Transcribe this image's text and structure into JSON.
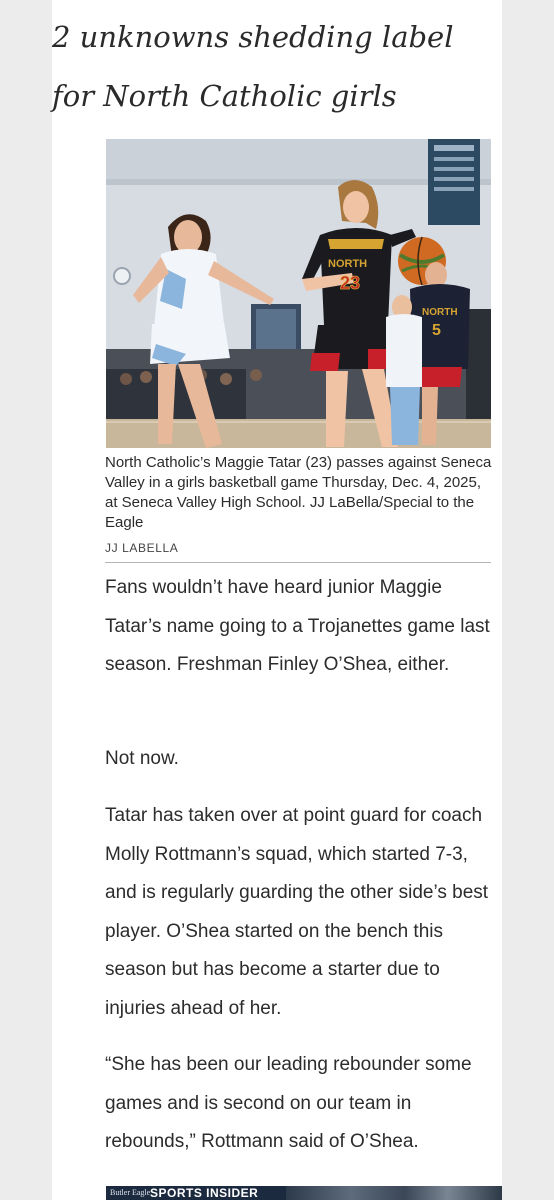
{
  "article": {
    "headline_line1": "2 unknowns shedding label",
    "headline_line2": "for North Catholic girls",
    "photo": {
      "description_icon": "basketball-photo",
      "jersey_text_front": "NORTH",
      "jersey_number_front": "23",
      "jersey_text_back": "NORTH",
      "jersey_number_back": "5"
    },
    "caption": "North Catholic’s Maggie Tatar (23) passes against Seneca Valley in a girls basketball game Thursday, Dec. 4, 2025, at Seneca Valley High School. JJ LaBella/Special to the Eagle",
    "credit": "JJ LABELLA",
    "paragraphs": [
      "Fans wouldn’t have heard junior Maggie Tatar’s name going to a Trojanettes game last season. Freshman Finley O’Shea, either.",
      "Not now.",
      "Tatar has taken over at point guard for coach Molly Rottmann’s squad, which started 7-3, and is regularly guarding the other side’s best player. O’Shea started on the bench this season but has become a starter due to injuries ahead of her.",
      "“She has been our leading rebounder some games and is second on our team in rebounds,” Rottmann said of O’Shea."
    ]
  },
  "banner": {
    "logo_text": "Butler Eagle",
    "title": "SPORTS INSIDER"
  },
  "colors": {
    "page_background": "#ececec",
    "article_background": "#ffffff",
    "text": "#2c2c2c",
    "north_catholic_red": "#c8202a",
    "seneca_blue": "#8bb5dc"
  }
}
